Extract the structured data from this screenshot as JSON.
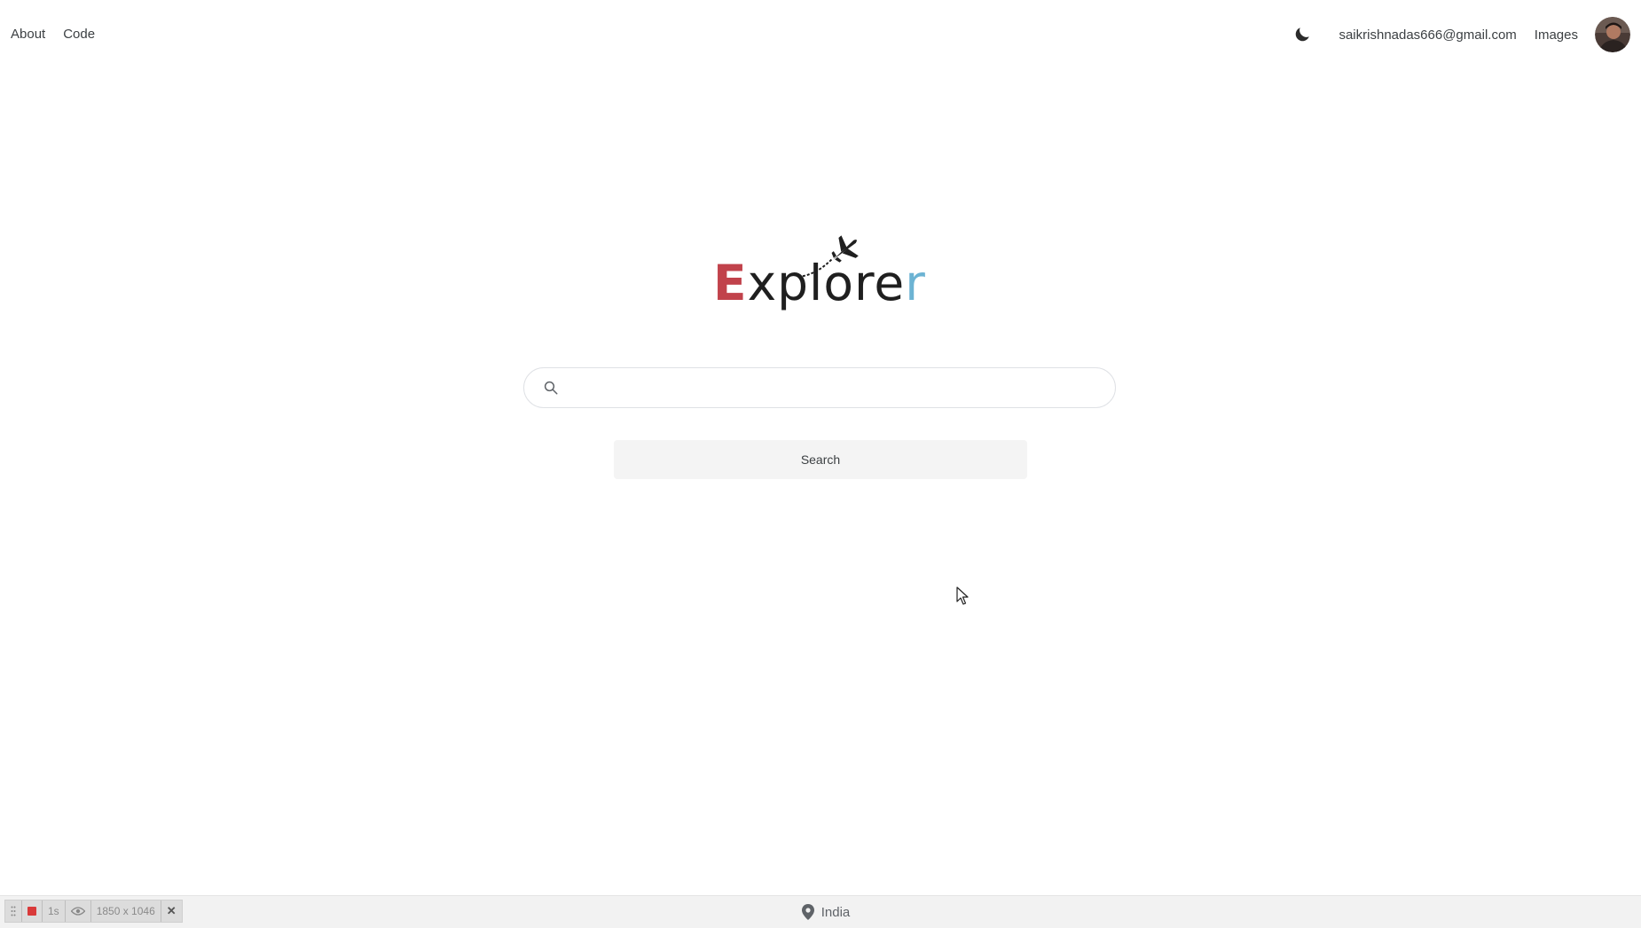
{
  "header": {
    "nav_left": [
      "About",
      "Code"
    ],
    "theme_toggle_icon": "moon-icon",
    "user_email": "saikrishnadas666@gmail.com",
    "images_link": "Images",
    "avatar_icon": "user-avatar"
  },
  "logo": {
    "text_first": "E",
    "text_middle": "xplore",
    "text_last": "r",
    "icon": "airplane-icon",
    "colors": {
      "first": "#c1424b",
      "middle": "#1f1f1f",
      "last": "#6cb3d3"
    }
  },
  "search": {
    "icon": "search-icon",
    "value": "",
    "button_label": "Search"
  },
  "footer": {
    "location_icon": "location-pin-icon",
    "location": "India"
  },
  "recorder": {
    "stop_icon": "stop-icon",
    "interval": "1s",
    "eye_icon": "eye-icon",
    "dimensions": "1850 x 1046",
    "close_label": "✕"
  }
}
